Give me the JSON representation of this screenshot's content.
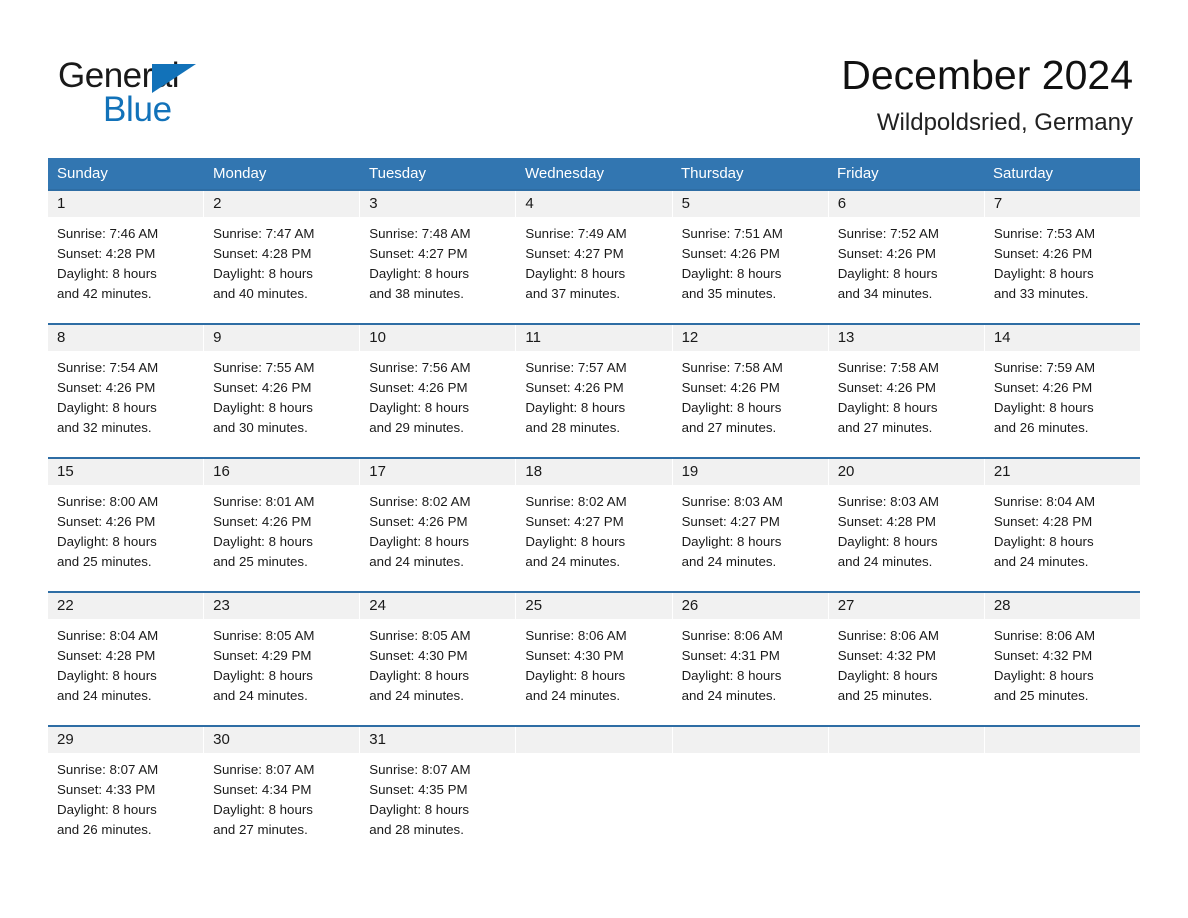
{
  "brand": {
    "name_part1": "General",
    "name_part2": "Blue",
    "triangle_icon": "triangle-icon",
    "accent_color": "#1272b9"
  },
  "header": {
    "month_title": "December 2024",
    "location": "Wildpoldsried, Germany"
  },
  "colors": {
    "header_blue": "#3276b1",
    "row_divider_blue": "#2e6da4",
    "day_number_band": "#f1f1f1"
  },
  "calendar": {
    "weekdays": [
      "Sunday",
      "Monday",
      "Tuesday",
      "Wednesday",
      "Thursday",
      "Friday",
      "Saturday"
    ],
    "labels": {
      "sunrise": "Sunrise:",
      "sunset": "Sunset:",
      "daylight": "Daylight:"
    },
    "weeks": [
      [
        {
          "day": "1",
          "sunrise": "Sunrise: 7:46 AM",
          "sunset": "Sunset: 4:28 PM",
          "daylight_line1": "Daylight: 8 hours",
          "daylight_line2": "and 42 minutes."
        },
        {
          "day": "2",
          "sunrise": "Sunrise: 7:47 AM",
          "sunset": "Sunset: 4:28 PM",
          "daylight_line1": "Daylight: 8 hours",
          "daylight_line2": "and 40 minutes."
        },
        {
          "day": "3",
          "sunrise": "Sunrise: 7:48 AM",
          "sunset": "Sunset: 4:27 PM",
          "daylight_line1": "Daylight: 8 hours",
          "daylight_line2": "and 38 minutes."
        },
        {
          "day": "4",
          "sunrise": "Sunrise: 7:49 AM",
          "sunset": "Sunset: 4:27 PM",
          "daylight_line1": "Daylight: 8 hours",
          "daylight_line2": "and 37 minutes."
        },
        {
          "day": "5",
          "sunrise": "Sunrise: 7:51 AM",
          "sunset": "Sunset: 4:26 PM",
          "daylight_line1": "Daylight: 8 hours",
          "daylight_line2": "and 35 minutes."
        },
        {
          "day": "6",
          "sunrise": "Sunrise: 7:52 AM",
          "sunset": "Sunset: 4:26 PM",
          "daylight_line1": "Daylight: 8 hours",
          "daylight_line2": "and 34 minutes."
        },
        {
          "day": "7",
          "sunrise": "Sunrise: 7:53 AM",
          "sunset": "Sunset: 4:26 PM",
          "daylight_line1": "Daylight: 8 hours",
          "daylight_line2": "and 33 minutes."
        }
      ],
      [
        {
          "day": "8",
          "sunrise": "Sunrise: 7:54 AM",
          "sunset": "Sunset: 4:26 PM",
          "daylight_line1": "Daylight: 8 hours",
          "daylight_line2": "and 32 minutes."
        },
        {
          "day": "9",
          "sunrise": "Sunrise: 7:55 AM",
          "sunset": "Sunset: 4:26 PM",
          "daylight_line1": "Daylight: 8 hours",
          "daylight_line2": "and 30 minutes."
        },
        {
          "day": "10",
          "sunrise": "Sunrise: 7:56 AM",
          "sunset": "Sunset: 4:26 PM",
          "daylight_line1": "Daylight: 8 hours",
          "daylight_line2": "and 29 minutes."
        },
        {
          "day": "11",
          "sunrise": "Sunrise: 7:57 AM",
          "sunset": "Sunset: 4:26 PM",
          "daylight_line1": "Daylight: 8 hours",
          "daylight_line2": "and 28 minutes."
        },
        {
          "day": "12",
          "sunrise": "Sunrise: 7:58 AM",
          "sunset": "Sunset: 4:26 PM",
          "daylight_line1": "Daylight: 8 hours",
          "daylight_line2": "and 27 minutes."
        },
        {
          "day": "13",
          "sunrise": "Sunrise: 7:58 AM",
          "sunset": "Sunset: 4:26 PM",
          "daylight_line1": "Daylight: 8 hours",
          "daylight_line2": "and 27 minutes."
        },
        {
          "day": "14",
          "sunrise": "Sunrise: 7:59 AM",
          "sunset": "Sunset: 4:26 PM",
          "daylight_line1": "Daylight: 8 hours",
          "daylight_line2": "and 26 minutes."
        }
      ],
      [
        {
          "day": "15",
          "sunrise": "Sunrise: 8:00 AM",
          "sunset": "Sunset: 4:26 PM",
          "daylight_line1": "Daylight: 8 hours",
          "daylight_line2": "and 25 minutes."
        },
        {
          "day": "16",
          "sunrise": "Sunrise: 8:01 AM",
          "sunset": "Sunset: 4:26 PM",
          "daylight_line1": "Daylight: 8 hours",
          "daylight_line2": "and 25 minutes."
        },
        {
          "day": "17",
          "sunrise": "Sunrise: 8:02 AM",
          "sunset": "Sunset: 4:26 PM",
          "daylight_line1": "Daylight: 8 hours",
          "daylight_line2": "and 24 minutes."
        },
        {
          "day": "18",
          "sunrise": "Sunrise: 8:02 AM",
          "sunset": "Sunset: 4:27 PM",
          "daylight_line1": "Daylight: 8 hours",
          "daylight_line2": "and 24 minutes."
        },
        {
          "day": "19",
          "sunrise": "Sunrise: 8:03 AM",
          "sunset": "Sunset: 4:27 PM",
          "daylight_line1": "Daylight: 8 hours",
          "daylight_line2": "and 24 minutes."
        },
        {
          "day": "20",
          "sunrise": "Sunrise: 8:03 AM",
          "sunset": "Sunset: 4:28 PM",
          "daylight_line1": "Daylight: 8 hours",
          "daylight_line2": "and 24 minutes."
        },
        {
          "day": "21",
          "sunrise": "Sunrise: 8:04 AM",
          "sunset": "Sunset: 4:28 PM",
          "daylight_line1": "Daylight: 8 hours",
          "daylight_line2": "and 24 minutes."
        }
      ],
      [
        {
          "day": "22",
          "sunrise": "Sunrise: 8:04 AM",
          "sunset": "Sunset: 4:28 PM",
          "daylight_line1": "Daylight: 8 hours",
          "daylight_line2": "and 24 minutes."
        },
        {
          "day": "23",
          "sunrise": "Sunrise: 8:05 AM",
          "sunset": "Sunset: 4:29 PM",
          "daylight_line1": "Daylight: 8 hours",
          "daylight_line2": "and 24 minutes."
        },
        {
          "day": "24",
          "sunrise": "Sunrise: 8:05 AM",
          "sunset": "Sunset: 4:30 PM",
          "daylight_line1": "Daylight: 8 hours",
          "daylight_line2": "and 24 minutes."
        },
        {
          "day": "25",
          "sunrise": "Sunrise: 8:06 AM",
          "sunset": "Sunset: 4:30 PM",
          "daylight_line1": "Daylight: 8 hours",
          "daylight_line2": "and 24 minutes."
        },
        {
          "day": "26",
          "sunrise": "Sunrise: 8:06 AM",
          "sunset": "Sunset: 4:31 PM",
          "daylight_line1": "Daylight: 8 hours",
          "daylight_line2": "and 24 minutes."
        },
        {
          "day": "27",
          "sunrise": "Sunrise: 8:06 AM",
          "sunset": "Sunset: 4:32 PM",
          "daylight_line1": "Daylight: 8 hours",
          "daylight_line2": "and 25 minutes."
        },
        {
          "day": "28",
          "sunrise": "Sunrise: 8:06 AM",
          "sunset": "Sunset: 4:32 PM",
          "daylight_line1": "Daylight: 8 hours",
          "daylight_line2": "and 25 minutes."
        }
      ],
      [
        {
          "day": "29",
          "sunrise": "Sunrise: 8:07 AM",
          "sunset": "Sunset: 4:33 PM",
          "daylight_line1": "Daylight: 8 hours",
          "daylight_line2": "and 26 minutes."
        },
        {
          "day": "30",
          "sunrise": "Sunrise: 8:07 AM",
          "sunset": "Sunset: 4:34 PM",
          "daylight_line1": "Daylight: 8 hours",
          "daylight_line2": "and 27 minutes."
        },
        {
          "day": "31",
          "sunrise": "Sunrise: 8:07 AM",
          "sunset": "Sunset: 4:35 PM",
          "daylight_line1": "Daylight: 8 hours",
          "daylight_line2": "and 28 minutes."
        },
        {
          "day": "",
          "sunrise": "",
          "sunset": "",
          "daylight_line1": "",
          "daylight_line2": ""
        },
        {
          "day": "",
          "sunrise": "",
          "sunset": "",
          "daylight_line1": "",
          "daylight_line2": ""
        },
        {
          "day": "",
          "sunrise": "",
          "sunset": "",
          "daylight_line1": "",
          "daylight_line2": ""
        },
        {
          "day": "",
          "sunrise": "",
          "sunset": "",
          "daylight_line1": "",
          "daylight_line2": ""
        }
      ]
    ]
  }
}
